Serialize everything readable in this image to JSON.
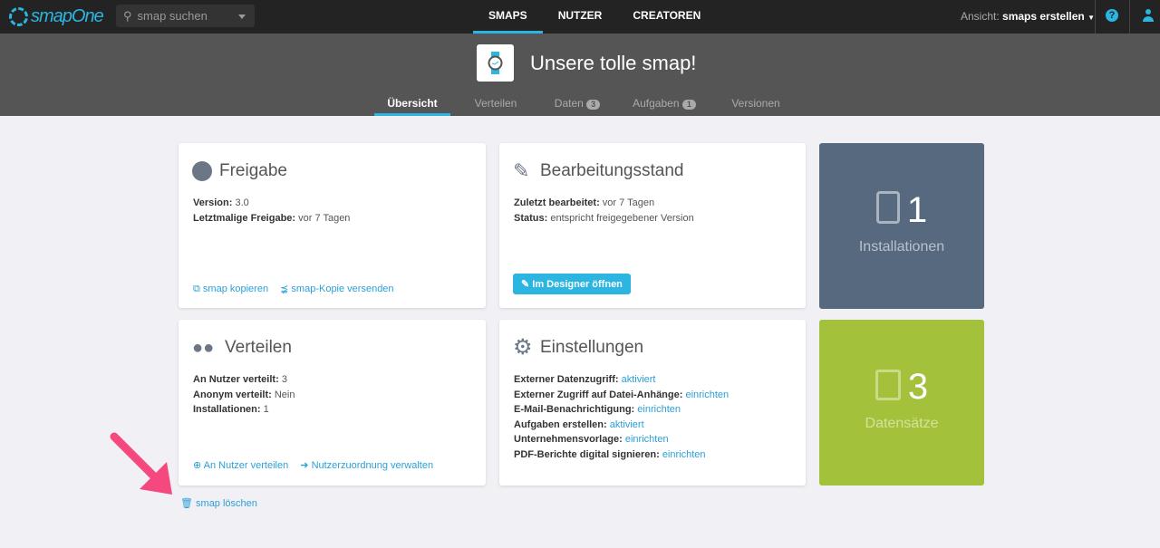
{
  "topbar": {
    "logo": "smapOne",
    "search_placeholder": "smap suchen",
    "nav": [
      "SMAPS",
      "NUTZER",
      "CREATOREN"
    ],
    "view_label": "Ansicht:",
    "view_value": "smaps erstellen",
    "help": "?"
  },
  "banner": {
    "title": "Unsere tolle smap!",
    "tabs": [
      {
        "label": "Übersicht"
      },
      {
        "label": "Verteilen"
      },
      {
        "label": "Daten",
        "badge": "3"
      },
      {
        "label": "Aufgaben",
        "badge": "1"
      },
      {
        "label": "Versionen"
      }
    ]
  },
  "freigabe": {
    "title": "Freigabe",
    "rows": [
      {
        "k": "Version:",
        "v": "3.0"
      },
      {
        "k": "Letztmalige Freigabe:",
        "v": "vor 7 Tagen"
      }
    ],
    "links": [
      "smap kopieren",
      "smap-Kopie versenden"
    ]
  },
  "bearbeitung": {
    "title": "Bearbeitungsstand",
    "rows": [
      {
        "k": "Zuletzt bearbeitet:",
        "v": "vor 7 Tagen"
      },
      {
        "k": "Status:",
        "v": "entspricht freigegebener Version"
      }
    ],
    "button": "Im Designer öffnen"
  },
  "verteilen": {
    "title": "Verteilen",
    "rows": [
      {
        "k": "An Nutzer verteilt:",
        "v": "3"
      },
      {
        "k": "Anonym verteilt:",
        "v": "Nein"
      },
      {
        "k": "Installationen:",
        "v": "1"
      }
    ],
    "links": [
      "An Nutzer verteilen",
      "Nutzerzuordnung verwalten"
    ]
  },
  "einstellungen": {
    "title": "Einstellungen",
    "rows": [
      {
        "k": "Externer Datenzugriff:",
        "v": "aktiviert"
      },
      {
        "k": "Externer Zugriff auf Datei-Anhänge:",
        "v": "einrichten"
      },
      {
        "k": "E-Mail-Benachrichtigung:",
        "v": "einrichten"
      },
      {
        "k": "Aufgaben erstellen:",
        "v": "aktiviert"
      },
      {
        "k": "Unternehmensvorlage:",
        "v": "einrichten"
      },
      {
        "k": "PDF-Berichte digital signieren:",
        "v": "einrichten"
      }
    ]
  },
  "tiles": {
    "installations": {
      "count": "1",
      "label": "Installationen",
      "color": "#56697e"
    },
    "records": {
      "count": "3",
      "label": "Datensätze",
      "color": "#a3c13b"
    }
  },
  "delete_link": "smap löschen"
}
